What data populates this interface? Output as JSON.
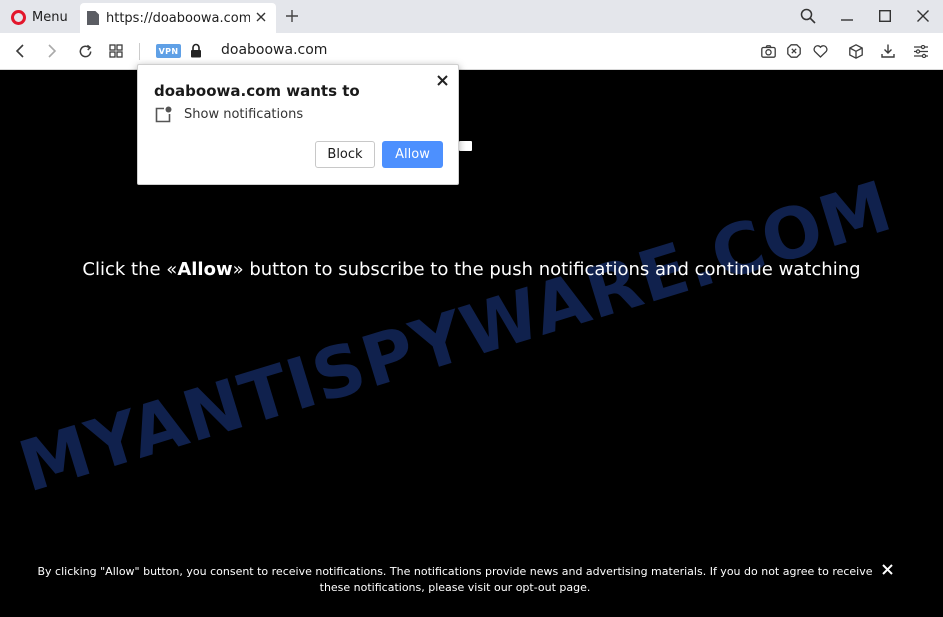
{
  "browser": {
    "menu_label": "Menu",
    "tab_title": "https://doaboowa.com",
    "new_tab_icon": "plus-icon",
    "vpn_label": "VPN",
    "url": "doaboowa.com",
    "icons": [
      "search-icon",
      "minimize-icon",
      "maximize-icon",
      "close-icon",
      "back-icon",
      "forward-icon",
      "reload-icon",
      "tabs-grid-icon",
      "lock-icon",
      "camera-icon",
      "block-ads-icon",
      "heart-icon",
      "cube-icon",
      "download-icon",
      "settings-icon"
    ],
    "brand_color": "#e3172c"
  },
  "popup": {
    "title": "doaboowa.com wants to",
    "permission": "Show notifications",
    "block_label": "Block",
    "allow_label": "Allow",
    "allow_color": "#4d90fe"
  },
  "page": {
    "headline_pre": "Click the «",
    "headline_bold": "Allow",
    "headline_post": "» button to subscribe to the push notifications and continue watching",
    "watermark": "MYANTISPYWARE.COM",
    "footer_text": "By clicking \"Allow\" button, you consent to receive notifications. The notifications provide news and advertising materials. If you do not agree to receive these notifications, please visit our",
    "footer_link": "opt-out page",
    "footer_end": "."
  }
}
